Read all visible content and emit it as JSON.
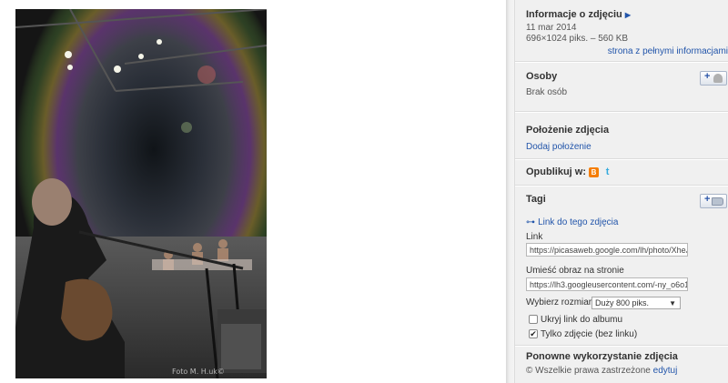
{
  "photo": {
    "watermark": "Foto M. H.uk©"
  },
  "info": {
    "title": "Informacje o zdjęciu",
    "date": "11 mar 2014",
    "dims": "696×1024 piks. – 560 KB",
    "full_info_link": "strona z pełnymi informacjami"
  },
  "people": {
    "title": "Osoby",
    "none": "Brak osób"
  },
  "location": {
    "title": "Położenie zdjęcia",
    "add": "Dodaj położenie"
  },
  "publish": {
    "title": "Opublikuj w:"
  },
  "tags": {
    "title": "Tagi",
    "photo_link": "Link do tego zdjęcia",
    "link_label": "Link",
    "link_value": "https://picasaweb.google.com/lh/photo/XheJs",
    "embed_label": "Umieść obraz na stronie",
    "embed_value": "https://lh3.googleusercontent.com/-ny_o6o1nl",
    "size_label": "Wybierz rozmiar",
    "size_value": "Duży 800 piks.",
    "hide_album": "Ukryj link do albumu",
    "only_photo": "Tylko zdjęcie (bez linku)"
  },
  "reuse": {
    "title": "Ponowne wykorzystanie zdjęcia",
    "rights": "Wszelkie prawa zastrzeżone",
    "edit": "edytuj"
  }
}
